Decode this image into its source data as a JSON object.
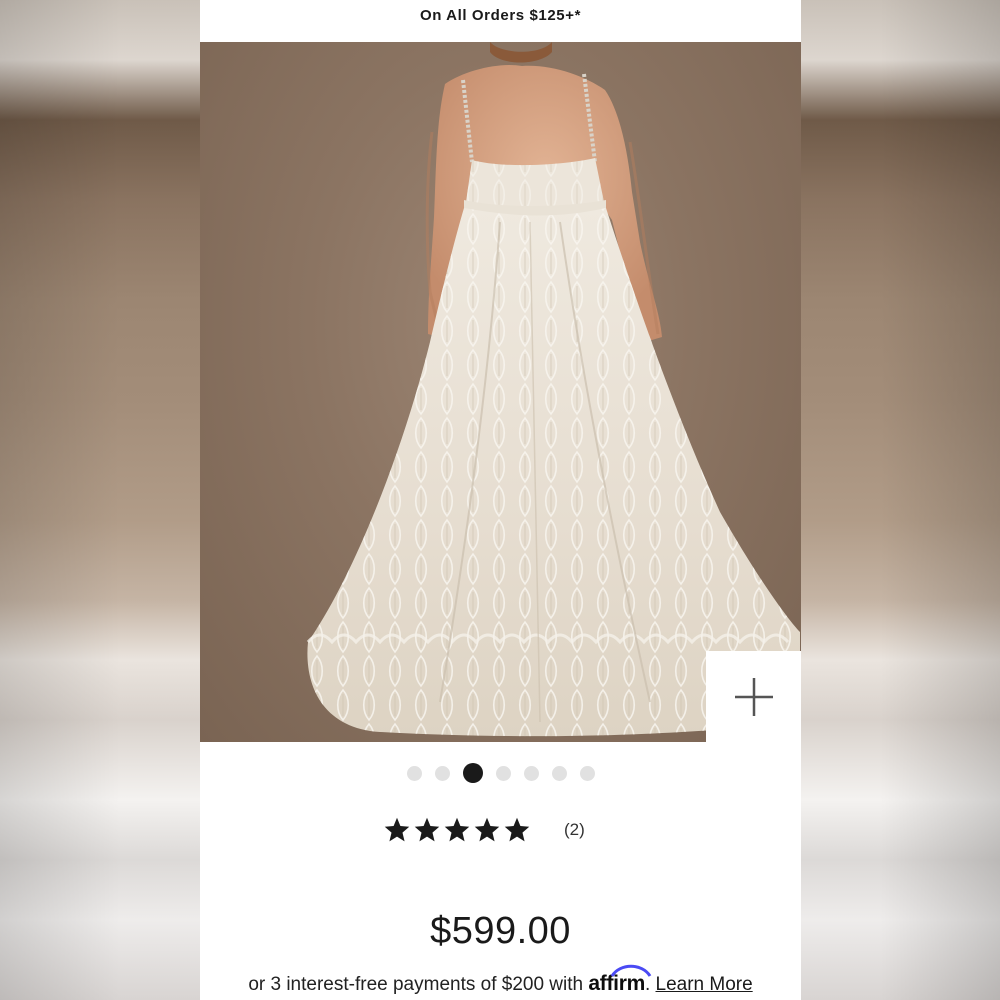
{
  "promo": {
    "text": "On All Orders $125+*"
  },
  "product_image": {
    "description_icon": "wedding-gown-back-view"
  },
  "zoom": {
    "icon": "plus-icon"
  },
  "carousel": {
    "total": 7,
    "active_index": 2
  },
  "rating": {
    "stars": 5,
    "count_label": "(2)"
  },
  "price": {
    "amount": "$599.00"
  },
  "financing": {
    "prefix": "or 3 interest-free payments of $200 with",
    "provider": "affirm",
    "suffix": ".",
    "link_label": "Learn More"
  },
  "colors": {
    "backdrop": "#8b7462",
    "text": "#1a1a1a",
    "dot_inactive": "#e1e1e1",
    "dot_active": "#1a1a1a",
    "affirm_blue": "#4a4af4"
  }
}
